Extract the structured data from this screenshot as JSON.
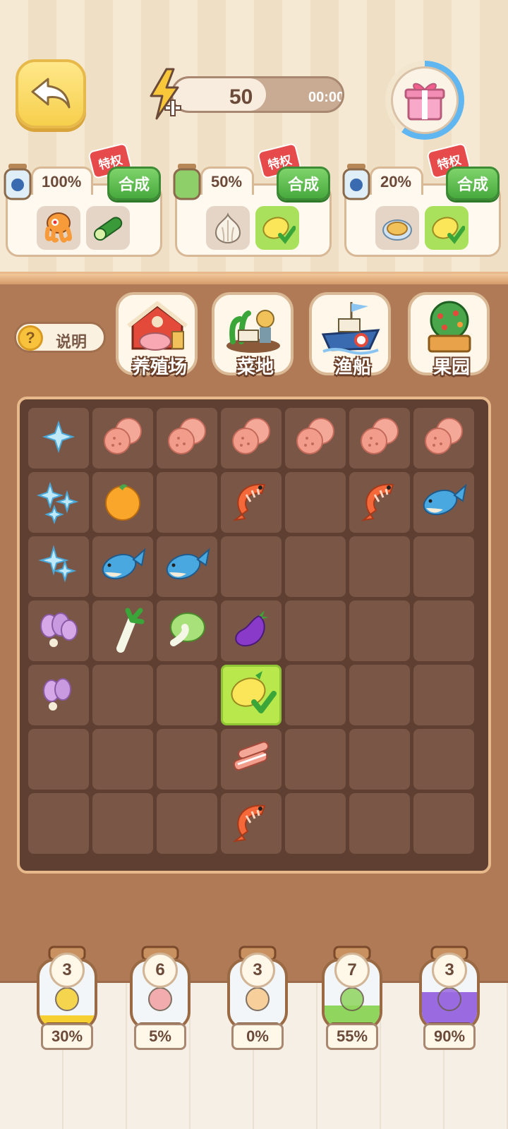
{
  "energy": {
    "value": "50",
    "timer": "00:00",
    "fill_fraction": 0.55
  },
  "gift": {
    "progress_fraction": 0.6
  },
  "orders": [
    {
      "percent": "100%",
      "badge": "特权",
      "merge_label": "合成",
      "items": [
        "octopus-icon",
        "cucumber-icon"
      ],
      "done": [
        false,
        false
      ]
    },
    {
      "percent": "50%",
      "badge": "特权",
      "merge_label": "合成",
      "items": [
        "garlic-icon",
        "lemon-icon"
      ],
      "done": [
        false,
        true
      ]
    },
    {
      "percent": "20%",
      "badge": "特权",
      "merge_label": "合成",
      "items": [
        "pie-icon",
        "lemon-icon"
      ],
      "done": [
        false,
        true
      ]
    }
  ],
  "help": {
    "label": "说明"
  },
  "buildings": [
    {
      "label": "养殖场",
      "icon": "farm-barn-icon"
    },
    {
      "label": "菜地",
      "icon": "vegetable-field-icon"
    },
    {
      "label": "渔船",
      "icon": "fishing-boat-icon"
    },
    {
      "label": "果园",
      "icon": "orchard-icon"
    }
  ],
  "board": {
    "rows": [
      [
        "sparkle-1",
        "meat",
        "meat",
        "meat",
        "meat",
        "meat",
        "meat"
      ],
      [
        "sparkle-3",
        "orange",
        "",
        "shrimp",
        "",
        "shrimp",
        "fish"
      ],
      [
        "sparkle-2",
        "fish",
        "fish",
        "",
        "",
        "",
        ""
      ],
      [
        "radish-bunch",
        "leek",
        "cabbage",
        "eggplant",
        "",
        "",
        ""
      ],
      [
        "radish-pair",
        "",
        "",
        "lemon-done",
        "",
        "",
        ""
      ],
      [
        "",
        "",
        "",
        "bacon",
        "",
        "",
        ""
      ],
      [
        "",
        "",
        "",
        "shrimp",
        "",
        "",
        ""
      ]
    ]
  },
  "jars": [
    {
      "count": "3",
      "percent": "30%",
      "fill": 0.3,
      "content": "coin-icon",
      "color": "#f5d030"
    },
    {
      "count": "6",
      "percent": "5%",
      "fill": 0.05,
      "content": "steak-icon",
      "color": "#f3a0a0"
    },
    {
      "count": "3",
      "percent": "0%",
      "fill": 0.0,
      "content": "octopus-icon",
      "color": "#f7c98a"
    },
    {
      "count": "7",
      "percent": "55%",
      "fill": 0.55,
      "content": "broccoli-icon",
      "color": "#8fd55e"
    },
    {
      "count": "3",
      "percent": "90%",
      "fill": 0.9,
      "content": "grapes-icon",
      "color": "#9a6ae0"
    }
  ]
}
